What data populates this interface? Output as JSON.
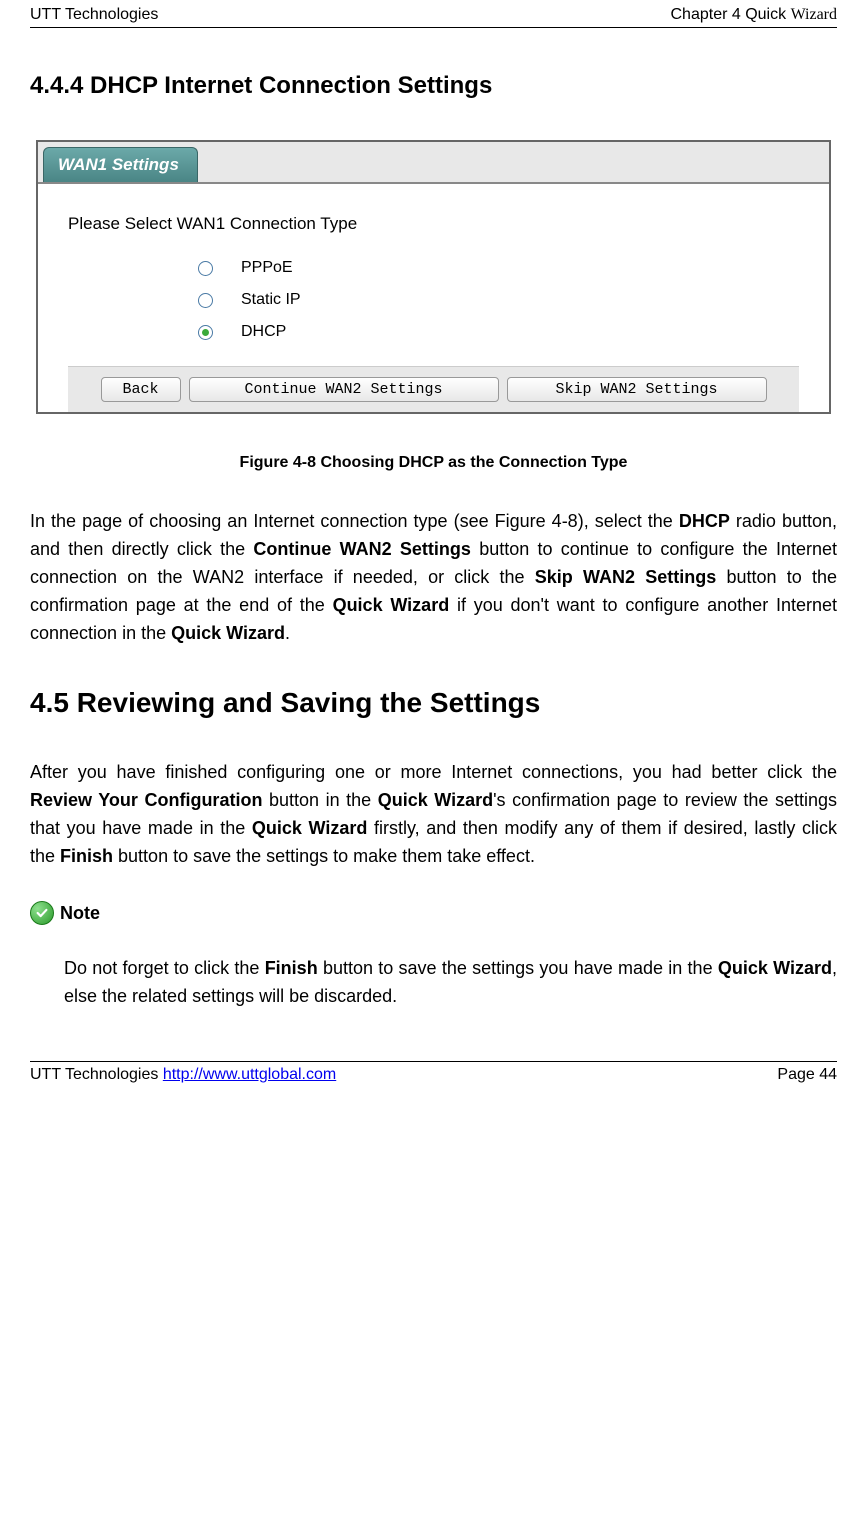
{
  "header": {
    "left": "UTT Technologies",
    "right_prefix": "Chapter 4 Quick ",
    "right_wizard": "Wizard"
  },
  "section_444": {
    "title": "4.4.4    DHCP Internet Connection Settings"
  },
  "screenshot": {
    "tab": "WAN1 Settings",
    "prompt": "Please Select WAN1 Connection Type",
    "options": {
      "pppoe": "PPPoE",
      "static": "Static IP",
      "dhcp": "DHCP"
    },
    "buttons": {
      "back": "Back",
      "continue": "Continue WAN2 Settings",
      "skip": "Skip WAN2 Settings"
    }
  },
  "figure_caption": "Figure 4-8 Choosing DHCP as the Connection Type",
  "para1": {
    "t1": "In the page of choosing an Internet connection type (see Figure 4-8), select the ",
    "b1": "DHCP",
    "t2": " radio button, and then directly click the ",
    "b2": "Continue WAN2 Settings",
    "t3": " button to continue to configure the Internet connection on the WAN2 interface if needed, or click the ",
    "b3": "Skip WAN2 Settings",
    "t4": " button to the confirmation page at the end of the ",
    "b4": "Quick Wizard",
    "t5": " if you don't want to configure another Internet connection in the ",
    "b5": "Quick Wizard",
    "t6": "."
  },
  "section_45": {
    "title": "4.5      Reviewing and Saving the Settings"
  },
  "para2": {
    "t1": "After you have finished configuring one or more Internet connections, you had better click the ",
    "b1": "Review Your Configuration",
    "t2": " button in the ",
    "b2": "Quick Wizard",
    "t3": "'s confirmation page to review the settings that you have made in the ",
    "b3": "Quick Wizard",
    "t4": " firstly, and then modify any of them if desired, lastly click the ",
    "b4": "Finish",
    "t5": " button to save the settings to make them take effect."
  },
  "note": {
    "label": "Note",
    "t1": "Do not forget to click the ",
    "b1": "Finish",
    "t2": " button to save the settings you have made in the ",
    "b2": "Quick Wizard",
    "t3": ", else the related settings will be discarded."
  },
  "footer": {
    "left_prefix": "UTT Technologies ",
    "link": "http://www.uttglobal.com",
    "right": "Page 44"
  }
}
